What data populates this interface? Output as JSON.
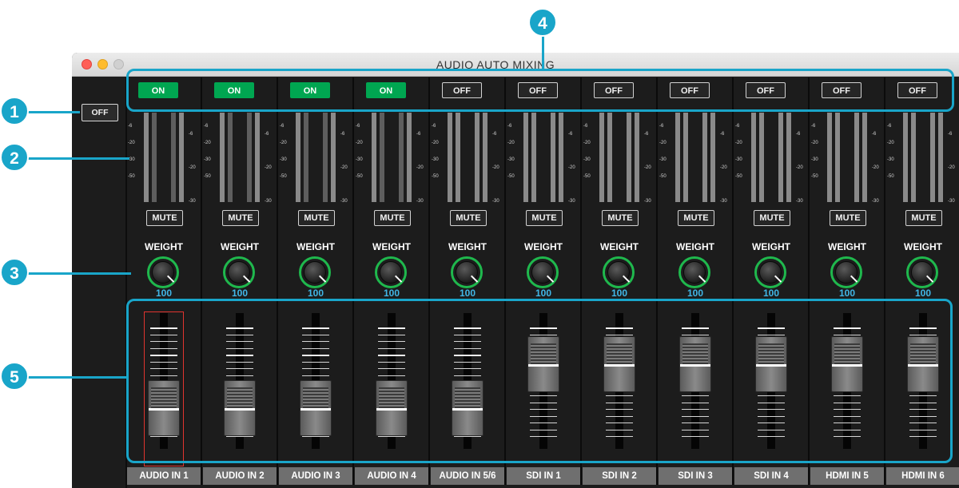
{
  "window": {
    "title": "AUDIO AUTO MIXING"
  },
  "master": {
    "label": "OFF"
  },
  "meter_scale": {
    "left": [
      "-6",
      "-20",
      "-30",
      "-50"
    ],
    "right": [
      "-6",
      "-20",
      "-30"
    ]
  },
  "mute_label": "MUTE",
  "weight_label": "WEIGHT",
  "channels": [
    {
      "name": "AUDIO IN 1",
      "auto": "ON",
      "weight": "100",
      "fader_level": 0.15,
      "selected": true
    },
    {
      "name": "AUDIO IN 2",
      "auto": "ON",
      "weight": "100",
      "fader_level": 0.15,
      "selected": false
    },
    {
      "name": "AUDIO IN 3",
      "auto": "ON",
      "weight": "100",
      "fader_level": 0.15,
      "selected": false
    },
    {
      "name": "AUDIO IN 4",
      "auto": "ON",
      "weight": "100",
      "fader_level": 0.15,
      "selected": false
    },
    {
      "name": "AUDIO IN 5/6",
      "auto": "OFF",
      "weight": "100",
      "fader_level": 0.15,
      "selected": false
    },
    {
      "name": "SDI IN 1",
      "auto": "OFF",
      "weight": "100",
      "fader_level": 0.72,
      "selected": false
    },
    {
      "name": "SDI IN 2",
      "auto": "OFF",
      "weight": "100",
      "fader_level": 0.72,
      "selected": false
    },
    {
      "name": "SDI IN 3",
      "auto": "OFF",
      "weight": "100",
      "fader_level": 0.72,
      "selected": false
    },
    {
      "name": "SDI IN 4",
      "auto": "OFF",
      "weight": "100",
      "fader_level": 0.72,
      "selected": false
    },
    {
      "name": "HDMI IN 5",
      "auto": "OFF",
      "weight": "100",
      "fader_level": 0.72,
      "selected": false
    },
    {
      "name": "HDMI IN 6",
      "auto": "OFF",
      "weight": "100",
      "fader_level": 0.72,
      "selected": false
    }
  ],
  "callouts": [
    "1",
    "2",
    "3",
    "4",
    "5"
  ],
  "colors": {
    "on": "#00a651",
    "callout": "#19a5c9",
    "weight_value": "#41b6e6",
    "knob_ring": "#1fb84d",
    "selected_outline": "#e0342f"
  }
}
